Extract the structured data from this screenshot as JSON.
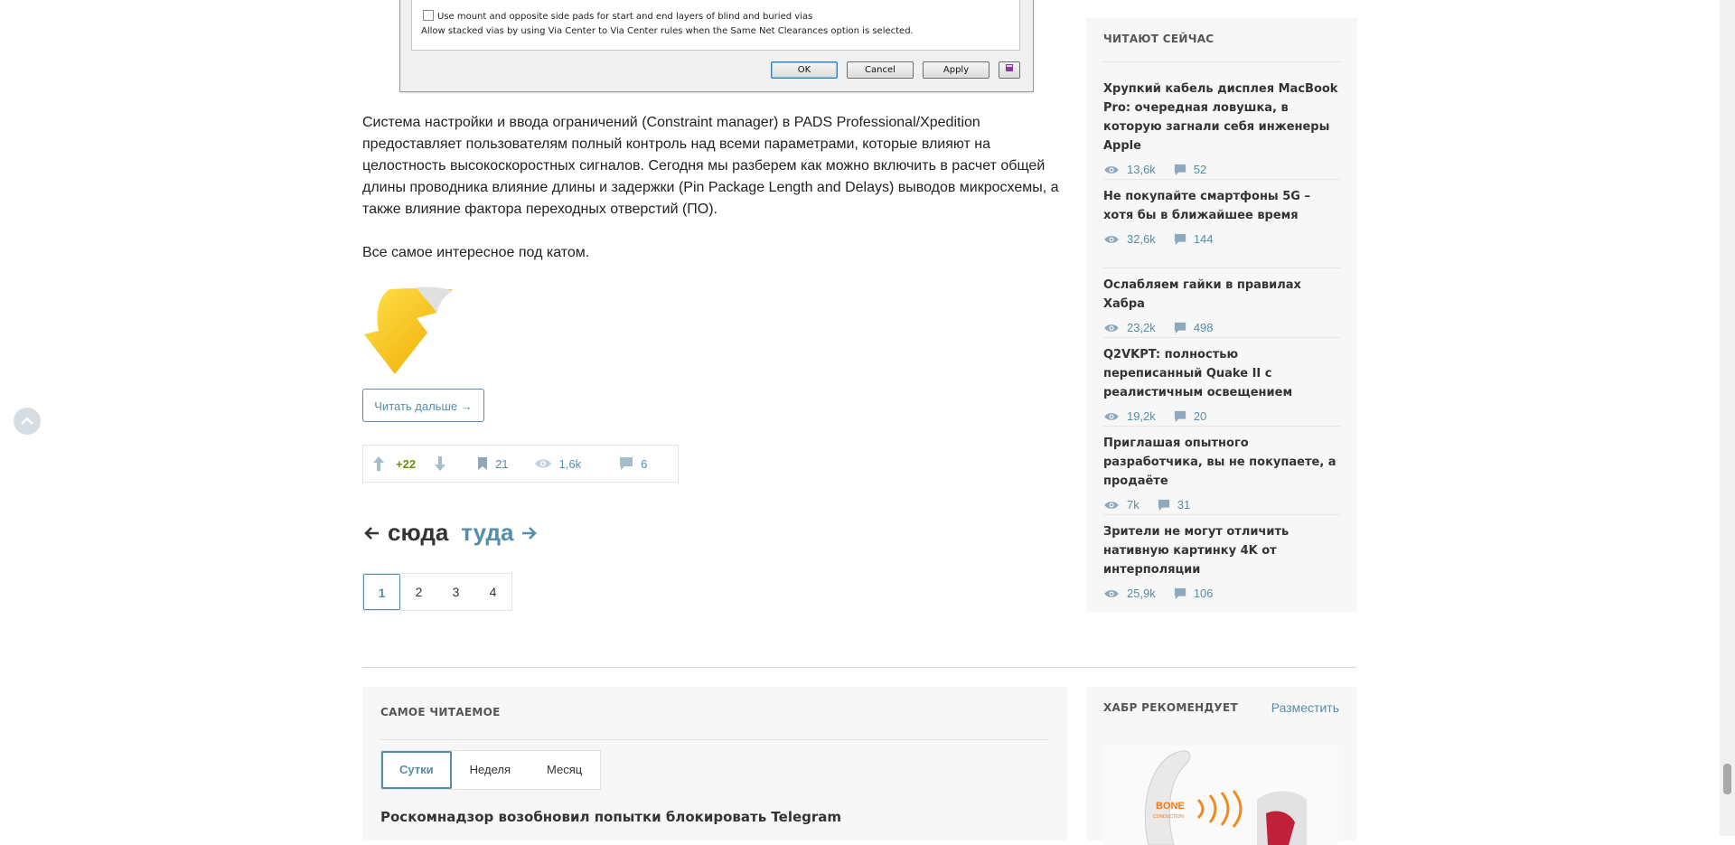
{
  "dialog": {
    "checkbox_label": "Use mount and opposite side pads for start and end layers of blind and buried vias",
    "note": "Allow stacked vias by using Via Center to Via Center rules when the Same Net Clearances option is selected.",
    "ok": "OK",
    "cancel": "Cancel",
    "apply": "Apply"
  },
  "article": {
    "paragraph": "Система настройки и ввода ограничений (Constraint manager) в PADS Professional/Xpedition предоставляет пользователям полный контроль над всеми параметрами, которые влияют на целостность высокоскоростных сигналов. Сегодня мы разберем как можно включить в расчет общей длины проводника влияние длины и задержки (Pin Package Length and Delays) выводов микросхемы, а также влияние фактора переходных отверстий (ПО).",
    "cut_text": "Все самое интересное под катом.",
    "read_more": "Читать дальше →",
    "score": "+22",
    "bookmarks": "21",
    "views": "1,6k",
    "comments": "6"
  },
  "pager": {
    "prev": "сюда",
    "next": "туда",
    "pages": [
      "1",
      "2",
      "3",
      "4"
    ],
    "current": "1"
  },
  "sidebar": {
    "title": "ЧИТАЮТ СЕЙЧАС",
    "items": [
      {
        "title": "Хрупкий кабель дисплея MacBook Pro: очередная ловушка, в которую загнали себя инженеры Apple",
        "views": "13,6k",
        "comments": "52"
      },
      {
        "title": "Не покупайте смартфоны 5G – хотя бы в ближайшее время",
        "views": "32,6k",
        "comments": "144"
      },
      {
        "title": "Ослабляем гайки в правилах Хабра",
        "views": "23,2k",
        "comments": "498"
      },
      {
        "title": "Q2VKPT: полностью переписанный Quake II с реалистичным освещением",
        "views": "19,2k",
        "comments": "20"
      },
      {
        "title": "Приглашая опытного разработчика, вы не покупаете, а продаёте",
        "views": "7k",
        "comments": "31"
      },
      {
        "title": "Зрители не могут отличить нативную картинку 4K от интерполяции",
        "views": "25,9k",
        "comments": "106"
      }
    ]
  },
  "most_read": {
    "title": "САМОЕ ЧИТАЕМОЕ",
    "tabs": [
      "Сутки",
      "Неделя",
      "Месяц"
    ],
    "first_item": "Роскомнадзор возобновил попытки блокировать Telegram"
  },
  "recommends": {
    "title": "ХАБР РЕКОМЕНДУЕТ",
    "link": "Разместить",
    "ad_text": "BONE",
    "ad_sub": "CONDUCTION"
  }
}
